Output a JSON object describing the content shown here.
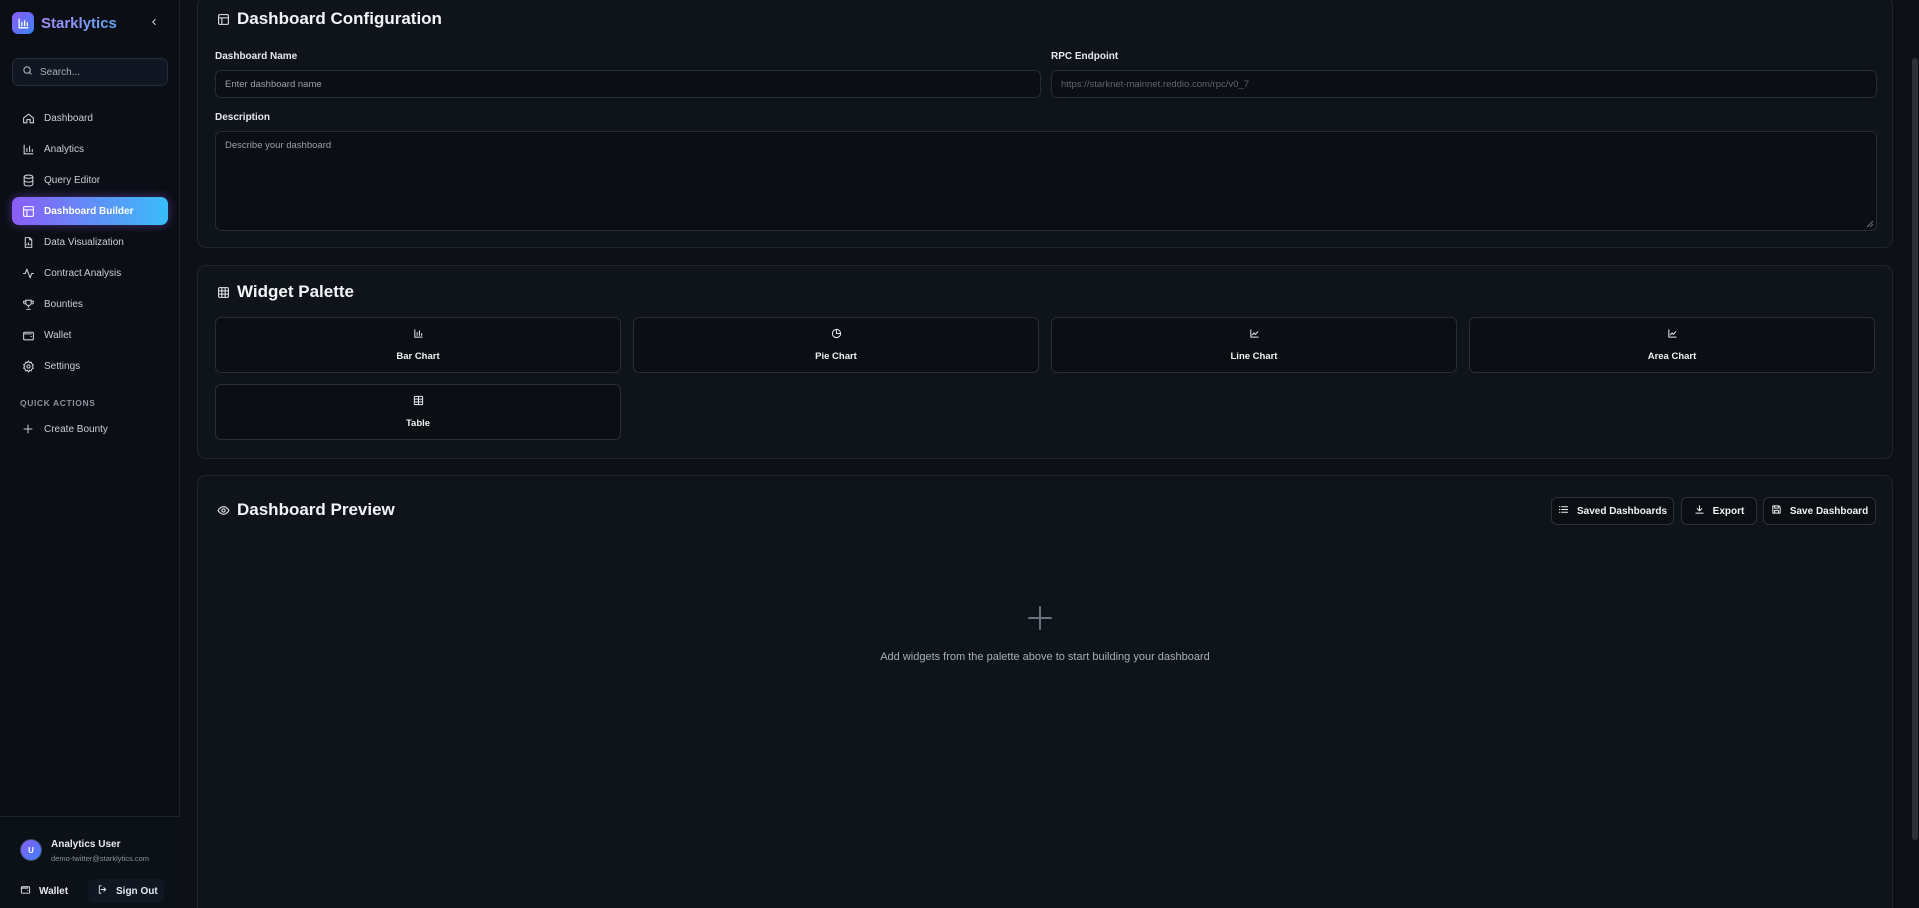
{
  "brand": {
    "name": "Starklytics",
    "logo_icon": "bar-chart-icon"
  },
  "search": {
    "placeholder": "Search..."
  },
  "sidebar": {
    "items": [
      {
        "label": "Dashboard",
        "icon": "home-icon"
      },
      {
        "label": "Analytics",
        "icon": "bar-chart-icon"
      },
      {
        "label": "Query Editor",
        "icon": "database-icon"
      },
      {
        "label": "Dashboard Builder",
        "icon": "layout-icon",
        "active": true
      },
      {
        "label": "Data Visualization",
        "icon": "file-chart-icon"
      },
      {
        "label": "Contract Analysis",
        "icon": "activity-icon"
      },
      {
        "label": "Bounties",
        "icon": "trophy-icon"
      },
      {
        "label": "Wallet",
        "icon": "wallet-icon"
      },
      {
        "label": "Settings",
        "icon": "gear-icon"
      }
    ],
    "quick_actions_title": "QUICK ACTIONS",
    "quick_actions": [
      {
        "label": "Create Bounty",
        "icon": "plus-icon"
      }
    ]
  },
  "user": {
    "initial": "U",
    "name": "Analytics User",
    "email": "demo-twitter@starklytics.com",
    "wallet_label": "Wallet",
    "signout_label": "Sign Out"
  },
  "config": {
    "title": "Dashboard Configuration",
    "name_label": "Dashboard Name",
    "name_placeholder": "Enter dashboard name",
    "rpc_label": "RPC Endpoint",
    "rpc_placeholder": "https://starknet-mainnet.reddio.com/rpc/v0_7",
    "description_label": "Description",
    "description_placeholder": "Describe your dashboard"
  },
  "palette": {
    "title": "Widget Palette",
    "widgets": [
      {
        "label": "Bar Chart",
        "icon": "bar-chart-icon"
      },
      {
        "label": "Pie Chart",
        "icon": "pie-chart-icon"
      },
      {
        "label": "Line Chart",
        "icon": "line-chart-icon"
      },
      {
        "label": "Area Chart",
        "icon": "area-chart-icon"
      },
      {
        "label": "Table",
        "icon": "table-icon"
      }
    ]
  },
  "preview": {
    "title": "Dashboard Preview",
    "saved_label": "Saved Dashboards",
    "export_label": "Export",
    "save_label": "Save Dashboard",
    "empty_text": "Add widgets from the palette above to start building your dashboard"
  },
  "colors": {
    "background": "#0d1117",
    "card": "#0f131a",
    "accent_start": "#8b5cf6",
    "accent_end": "#38bdf8"
  }
}
